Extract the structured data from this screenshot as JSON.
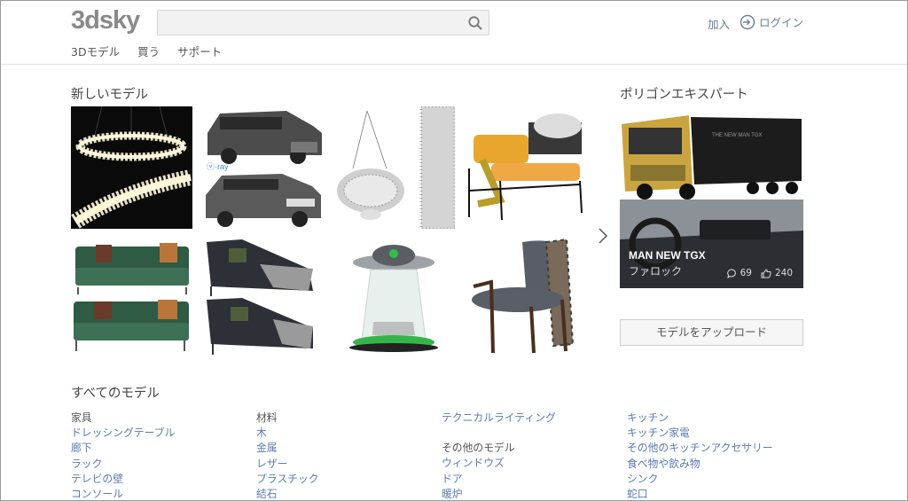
{
  "header": {
    "logo": "3dsky",
    "search_placeholder": "",
    "nav": [
      "3Dモデル",
      "買う",
      "サポート"
    ],
    "join": "加入",
    "login": "ログイン"
  },
  "new_models": {
    "title": "新しいモデル",
    "items": [
      "chandelier-ring-model",
      "car-model",
      "hanging-plant-model",
      "armchair-ottoman-model",
      "sofa-model",
      "chaise-lounge-model",
      "ufo-lamp-model",
      "lounge-chair-model"
    ]
  },
  "experts": {
    "title": "ポリゴンエキスパート",
    "model_name": "MAN NEW TGX",
    "author": "ファロック",
    "comments": "69",
    "likes": "240"
  },
  "upload_button": "モデルをアップロード",
  "all_models": {
    "title": "すべてのモデル",
    "columns": [
      {
        "head": "家具",
        "links": [
          "ドレッシングテーブル",
          "廊下",
          "ラック",
          "テレビの壁",
          "コンソール"
        ]
      },
      {
        "head": "材料",
        "links": [
          "木",
          "金属",
          "レザー",
          "プラスチック",
          "結石"
        ]
      },
      {
        "head": "",
        "links": [
          "テクニカルライティング"
        ],
        "head2": "その他のモデル",
        "links2": [
          "ウィンドウズ",
          "ドア",
          "暖炉"
        ]
      },
      {
        "head": "",
        "links": [
          "キッチン",
          "キッチン家電",
          "その他のキッチンアクセサリー",
          "食べ物や飲み物",
          "シンク",
          "蛇口"
        ]
      }
    ]
  },
  "colors": {
    "link": "#5a7bb5",
    "logo": "#8a8a8a",
    "header_link": "#6b7c99"
  }
}
